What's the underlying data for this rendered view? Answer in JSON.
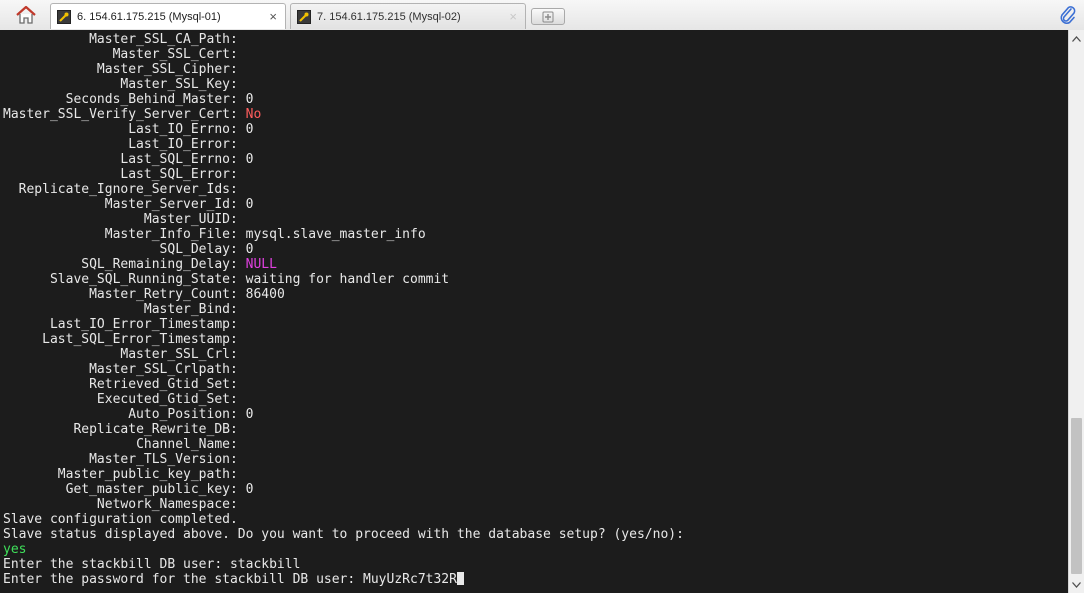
{
  "tabs": [
    {
      "label": "6. 154.61.175.215 (Mysql-01)",
      "close": "×"
    },
    {
      "label": "7. 154.61.175.215 (Mysql-02)",
      "close": "×"
    }
  ],
  "terminal": {
    "fields": [
      {
        "key": "Master_SSL_CA_Path:",
        "value": ""
      },
      {
        "key": "Master_SSL_Cert:",
        "value": ""
      },
      {
        "key": "Master_SSL_Cipher:",
        "value": ""
      },
      {
        "key": "Master_SSL_Key:",
        "value": ""
      },
      {
        "key": "Seconds_Behind_Master:",
        "value": "0"
      },
      {
        "key": "Master_SSL_Verify_Server_Cert:",
        "value": "No",
        "color": "red"
      },
      {
        "key": "Last_IO_Errno:",
        "value": "0"
      },
      {
        "key": "Last_IO_Error:",
        "value": ""
      },
      {
        "key": "Last_SQL_Errno:",
        "value": "0"
      },
      {
        "key": "Last_SQL_Error:",
        "value": ""
      },
      {
        "key": "Replicate_Ignore_Server_Ids:",
        "value": ""
      },
      {
        "key": "Master_Server_Id:",
        "value": "0"
      },
      {
        "key": "Master_UUID:",
        "value": ""
      },
      {
        "key": "Master_Info_File:",
        "value": "mysql.slave_master_info"
      },
      {
        "key": "SQL_Delay:",
        "value": "0"
      },
      {
        "key": "SQL_Remaining_Delay:",
        "value": "NULL",
        "color": "magenta"
      },
      {
        "key": "Slave_SQL_Running_State:",
        "value": "waiting for handler commit"
      },
      {
        "key": "Master_Retry_Count:",
        "value": "86400"
      },
      {
        "key": "Master_Bind:",
        "value": ""
      },
      {
        "key": "Last_IO_Error_Timestamp:",
        "value": ""
      },
      {
        "key": "Last_SQL_Error_Timestamp:",
        "value": ""
      },
      {
        "key": "Master_SSL_Crl:",
        "value": ""
      },
      {
        "key": "Master_SSL_Crlpath:",
        "value": ""
      },
      {
        "key": "Retrieved_Gtid_Set:",
        "value": ""
      },
      {
        "key": "Executed_Gtid_Set:",
        "value": ""
      },
      {
        "key": "Auto_Position:",
        "value": "0"
      },
      {
        "key": "Replicate_Rewrite_DB:",
        "value": ""
      },
      {
        "key": "Channel_Name:",
        "value": ""
      },
      {
        "key": "Master_TLS_Version:",
        "value": ""
      },
      {
        "key": "Master_public_key_path:",
        "value": ""
      },
      {
        "key": "Get_master_public_key:",
        "value": "0"
      },
      {
        "key": "Network_Namespace:",
        "value": ""
      }
    ],
    "lines": [
      {
        "text": "Slave configuration completed."
      },
      {
        "text": "Slave status displayed above. Do you want to proceed with the database setup? (yes/no):"
      },
      {
        "text": "yes",
        "color": "green"
      },
      {
        "text": "Enter the stackbill DB user: stackbill"
      },
      {
        "text": "Enter the password for the stackbill DB user: MuyUzRc7t32R",
        "cursor": true
      }
    ]
  },
  "icons": {
    "home": "home-icon",
    "tab": "wrench-terminal-icon",
    "new_tab": "plus-icon",
    "attach": "paperclip-icon",
    "scroll_up": "arrow-up-icon",
    "scroll_down": "arrow-down-icon"
  },
  "colors": {
    "terminal_bg": "#1c1c1c",
    "text": "#e8e8e8",
    "red": "#ff5d5d",
    "magenta": "#e040e0",
    "green": "#3fe05a"
  }
}
